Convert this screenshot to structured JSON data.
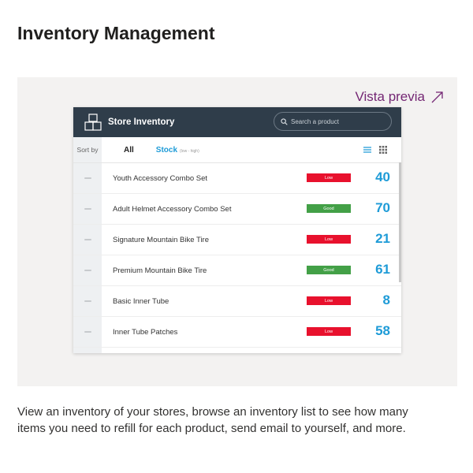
{
  "page": {
    "title": "Inventory Management",
    "preview_label": "Vista previa",
    "description": "View an inventory of your stores, browse an inventory list to see how many items you need to refill for each product, send email to yourself, and more."
  },
  "app": {
    "title": "Store Inventory",
    "search_placeholder": "Search a product",
    "sort_label": "Sort by",
    "tab_all": "All",
    "tab_stock": "Stock",
    "tab_stock_hint": "(low - high)",
    "items": [
      {
        "name": "Youth Accessory Combo Set",
        "status": "Low",
        "qty": "40"
      },
      {
        "name": "Adult Helmet Accessory Combo Set",
        "status": "Good",
        "qty": "70"
      },
      {
        "name": "Signature Mountain Bike Tire",
        "status": "Low",
        "qty": "21"
      },
      {
        "name": "Premium Mountain Bike Tire",
        "status": "Good",
        "qty": "61"
      },
      {
        "name": "Basic Inner Tube",
        "status": "Low",
        "qty": "8"
      },
      {
        "name": "Inner Tube Patches",
        "status": "Low",
        "qty": "58"
      }
    ]
  },
  "colors": {
    "accent": "#1e9bd7",
    "header_bg": "#2f3d4a",
    "low": "#e8112d",
    "good": "#43a047",
    "link": "#742774"
  },
  "icons": {
    "preview": "external-link-icon",
    "logo": "boxes-icon",
    "search": "search-icon",
    "list_view": "list-view-icon",
    "grid_view": "grid-view-icon"
  }
}
